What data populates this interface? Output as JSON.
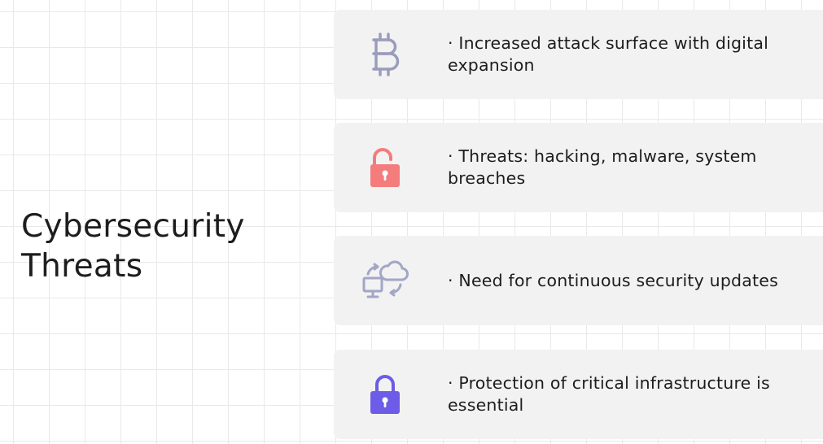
{
  "title": "Cybersecurity Threats",
  "colors": {
    "card_background": "#f2f2f2",
    "bitcoin_icon": "#9a9cbc",
    "unlock_icon": "#f47c7c",
    "sync_icon": "#a3a6c6",
    "lock_icon": "#6c5ce7"
  },
  "items": [
    {
      "icon": "bitcoin-icon",
      "text": "· Increased attack surface with digital expansion"
    },
    {
      "icon": "unlocked-padlock-icon",
      "text": "· Threats: hacking, malware, system breaches"
    },
    {
      "icon": "computer-cloud-sync-icon",
      "text": "· Need for continuous security updates"
    },
    {
      "icon": "locked-padlock-icon",
      "text": "· Protection of critical infrastructure is essential"
    }
  ]
}
